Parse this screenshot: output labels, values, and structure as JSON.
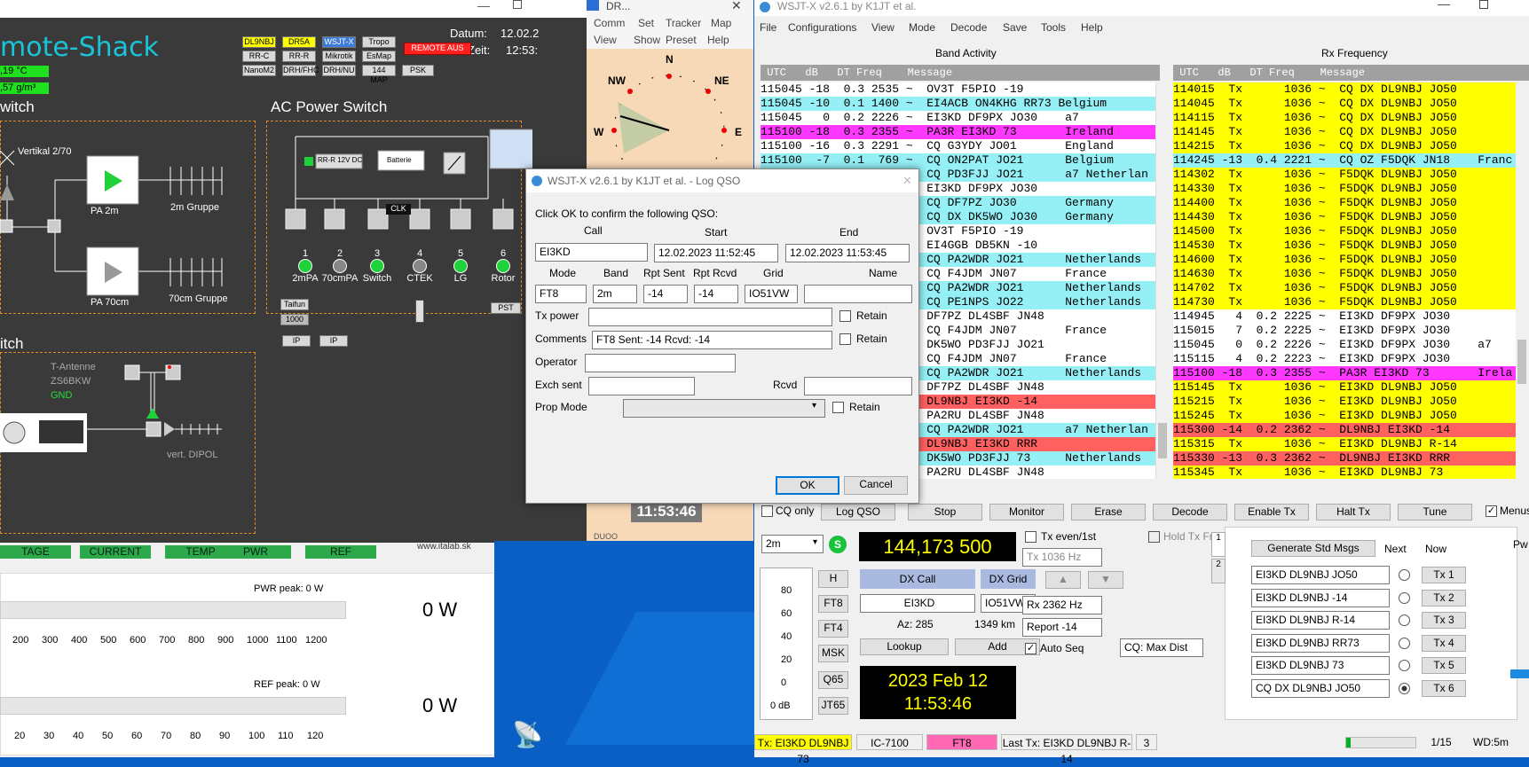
{
  "shack": {
    "title": "mote-Shack",
    "date_label": "Datum:",
    "date_value": "12.02.2",
    "time_label": "Zeit:",
    "time_value": "12:53:",
    "temp": ",19  °C",
    "humidity": ",57 g/m³",
    "buttons": [
      "DL9NBJ",
      "DR5A",
      "WSJT-X",
      "Tropo",
      "RR-C",
      "RR-R",
      "Mikrotik",
      "EsMap",
      "NanoM2",
      "DRH/FHC",
      "DRH/NU",
      "144 MAP",
      "PSK"
    ],
    "remote_off": "REMOTE AUS",
    "switch_header": "witch",
    "vertikal": "Vertikal 2/70",
    "pa2m": "PA 2m",
    "gruppe2m": "2m Gruppe",
    "pa70": "PA 70cm",
    "gruppe70": "70cm Gruppe",
    "ac_header": "AC Power Switch",
    "psu": "RR-R 12V DC",
    "batterie": "Batterie",
    "clk": "CLK",
    "outlets": [
      {
        "n": "1",
        "label": "2mPA",
        "on": true
      },
      {
        "n": "2",
        "label": "70cmPA",
        "on": false
      },
      {
        "n": "3",
        "label": "Switch",
        "on": true
      },
      {
        "n": "4",
        "label": "CTEK",
        "on": false
      },
      {
        "n": "5",
        "label": "LG",
        "on": true
      },
      {
        "n": "6",
        "label": "Rotor",
        "on": true
      }
    ],
    "taifun": "Taifun",
    "t1000": "1000",
    "pst": "PST",
    "ip": "IP",
    "switch2_header": "itch",
    "t_antenne": "T-Antenne",
    "zs6bkw": "ZS6BKW",
    "gnd": "GND",
    "vert_dipol": "vert. DIPOL",
    "tabs": [
      "TAGE",
      "CURRENT",
      "TEMP",
      "PWR",
      "REF"
    ],
    "website": "www.italab.sk",
    "pwr_peak": "PWR peak: 0 W",
    "pwr_value": "0 W",
    "pwr_ticks": [
      "200",
      "300",
      "400",
      "500",
      "600",
      "700",
      "800",
      "900",
      "1000",
      "1100",
      "1200"
    ],
    "ref_peak": "REF peak: 0 W",
    "ref_value": "0 W",
    "ref_ticks": [
      "20",
      "30",
      "40",
      "50",
      "60",
      "70",
      "80",
      "90",
      "100",
      "110",
      "120"
    ]
  },
  "dr": {
    "title": "DR...",
    "menu1": [
      "Comm",
      "Set",
      "Tracker",
      "Map"
    ],
    "menu2": [
      "View",
      "Show",
      "Preset",
      "Help"
    ],
    "compass": [
      "N",
      "NE",
      "E",
      "NW",
      "W"
    ],
    "clock": "11:53:46",
    "bottom": "DUOO"
  },
  "wsjt": {
    "title": "WSJT-X   v2.6.1   by K1JT et al.",
    "menu": [
      "File",
      "Configurations",
      "View",
      "Mode",
      "Decode",
      "Save",
      "Tools",
      "Help"
    ],
    "band_activity": "Band Activity",
    "rx_frequency": "Rx Frequency",
    "list_header": " UTC   dB   DT Freq    Message",
    "band_rows": [
      {
        "t": "115045 -18  0.3 2535 ~  OV3T F5PIO -19",
        "c": ""
      },
      {
        "t": "115045 -10  0.1 1400 ~  EI4ACB ON4KHG RR73 Belgium",
        "c": "cyan"
      },
      {
        "t": "115045   0  0.2 2226 ~  EI3KD DF9PX JO30    a7",
        "c": ""
      },
      {
        "t": "115100 -18  0.3 2355 ~  PA3R EI3KD 73       Ireland",
        "c": "mag"
      },
      {
        "t": "115100 -16  0.3 2291 ~  CQ G3YDY JO01       England",
        "c": ""
      },
      {
        "t": "115100  -7  0.1  769 ~  CQ ON2PAT JO21      Belgium",
        "c": "cyan"
      },
      {
        "t": "                        CQ PD3FJJ JO21      a7 Netherlan",
        "c": "cyan"
      },
      {
        "t": "                        EI3KD DF9PX JO30",
        "c": ""
      },
      {
        "t": "                        CQ DF7PZ JO30       Germany",
        "c": "cyan"
      },
      {
        "t": "                        CQ DX DK5WO JO30    Germany",
        "c": "cyan"
      },
      {
        "t": "                        OV3T F5PIO -19",
        "c": ""
      },
      {
        "t": "                        EI4GGB DB5KN -10",
        "c": ""
      },
      {
        "t": "                        CQ PA2WDR JO21      Netherlands",
        "c": "cyan"
      },
      {
        "t": "                        CQ F4JDM JN07       France",
        "c": ""
      },
      {
        "t": "                        CQ PA2WDR JO21      Netherlands",
        "c": "cyan"
      },
      {
        "t": "                        CQ PE1NPS JO22      Netherlands",
        "c": "cyan"
      },
      {
        "t": "                        DF7PZ DL4SBF JN48",
        "c": ""
      },
      {
        "t": "                        CQ F4JDM JN07       France",
        "c": ""
      },
      {
        "t": "                        DK5WO PD3FJJ JO21",
        "c": ""
      },
      {
        "t": "                        CQ F4JDM JN07       France",
        "c": ""
      },
      {
        "t": "                        CQ PA2WDR JO21      Netherlands",
        "c": "cyan"
      },
      {
        "t": "                        DF7PZ DL4SBF JN48",
        "c": ""
      },
      {
        "t": "                        DL9NBJ EI3KD -14",
        "c": "red"
      },
      {
        "t": "                        PA2RU DL4SBF JN48",
        "c": ""
      },
      {
        "t": "                        CQ PA2WDR JO21      a7 Netherlan",
        "c": "cyan"
      },
      {
        "t": "                        DL9NBJ EI3KD RRR",
        "c": "red"
      },
      {
        "t": "                        DK5WO PD3FJJ 73     Netherlands",
        "c": "cyan"
      },
      {
        "t": "                        PA2RU DL4SBF JN48",
        "c": ""
      }
    ],
    "rx_rows": [
      {
        "t": "114015  Tx      1036 ~  CQ DX DL9NBJ JO50",
        "c": "yel"
      },
      {
        "t": "114045  Tx      1036 ~  CQ DX DL9NBJ JO50",
        "c": "yel"
      },
      {
        "t": "114115  Tx      1036 ~  CQ DX DL9NBJ JO50",
        "c": "yel"
      },
      {
        "t": "114145  Tx      1036 ~  CQ DX DL9NBJ JO50",
        "c": "yel"
      },
      {
        "t": "114215  Tx      1036 ~  CQ DX DL9NBJ JO50",
        "c": "yel"
      },
      {
        "t": "114245 -13  0.4 2221 ~  CQ OZ F5DQK JN18    Franc",
        "c": "cyan"
      },
      {
        "t": "114302  Tx      1036 ~  F5DQK DL9NBJ JO50",
        "c": "yel"
      },
      {
        "t": "114330  Tx      1036 ~  F5DQK DL9NBJ JO50",
        "c": "yel"
      },
      {
        "t": "114400  Tx      1036 ~  F5DQK DL9NBJ JO50",
        "c": "yel"
      },
      {
        "t": "114430  Tx      1036 ~  F5DQK DL9NBJ JO50",
        "c": "yel"
      },
      {
        "t": "114500  Tx      1036 ~  F5DQK DL9NBJ JO50",
        "c": "yel"
      },
      {
        "t": "114530  Tx      1036 ~  F5DQK DL9NBJ JO50",
        "c": "yel"
      },
      {
        "t": "114600  Tx      1036 ~  F5DQK DL9NBJ JO50",
        "c": "yel"
      },
      {
        "t": "114630  Tx      1036 ~  F5DQK DL9NBJ JO50",
        "c": "yel"
      },
      {
        "t": "114702  Tx      1036 ~  F5DQK DL9NBJ JO50",
        "c": "yel"
      },
      {
        "t": "114730  Tx      1036 ~  F5DQK DL9NBJ JO50",
        "c": "yel"
      },
      {
        "t": "114945   4  0.2 2225 ~  EI3KD DF9PX JO30",
        "c": ""
      },
      {
        "t": "115015   7  0.2 2225 ~  EI3KD DF9PX JO30",
        "c": ""
      },
      {
        "t": "115045   0  0.2 2226 ~  EI3KD DF9PX JO30    a7",
        "c": ""
      },
      {
        "t": "115115   4  0.2 2223 ~  EI3KD DF9PX JO30",
        "c": ""
      },
      {
        "t": "115100 -18  0.3 2355 ~  PA3R EI3KD 73       Irela",
        "c": "mag"
      },
      {
        "t": "115145  Tx      1036 ~  EI3KD DL9NBJ JO50",
        "c": "yel"
      },
      {
        "t": "115215  Tx      1036 ~  EI3KD DL9NBJ JO50",
        "c": "yel"
      },
      {
        "t": "115245  Tx      1036 ~  EI3KD DL9NBJ JO50",
        "c": "yel"
      },
      {
        "t": "115300 -14  0.2 2362 ~  DL9NBJ EI3KD -14",
        "c": "red"
      },
      {
        "t": "115315  Tx      1036 ~  EI3KD DL9NBJ R-14",
        "c": "yel"
      },
      {
        "t": "115330 -13  0.3 2362 ~  DL9NBJ EI3KD RRR",
        "c": "red"
      },
      {
        "t": "115345  Tx      1036 ~  EI3KD DL9NBJ 73",
        "c": "yel"
      }
    ],
    "cq_only": "CQ only",
    "buttons": [
      "Log QSO",
      "Stop",
      "Monitor",
      "Erase",
      "Decode",
      "Enable Tx",
      "Halt Tx",
      "Tune"
    ],
    "menus": "Menus",
    "band": "2m",
    "frequency": "144,173 500",
    "tx_even": "Tx even/1st",
    "hold_tx_freq": "Hold Tx Freq",
    "tx_hz": "Tx  1036  Hz",
    "rx_hz": "Rx  2362  Hz",
    "report": "Report -14",
    "auto_seq": "Auto Seq",
    "cq_max_dist": "CQ: Max Dist",
    "dx_call_label": "DX Call",
    "dx_grid_label": "DX Grid",
    "dx_call": "EI3KD",
    "dx_grid": "IO51VW",
    "az": "Az: 285",
    "km": "1349 km",
    "lookup": "Lookup",
    "add": "Add",
    "date": "2023 Feb 12",
    "clock": "11:53:46",
    "modes": [
      "H",
      "FT8",
      "FT4",
      "MSK",
      "Q65",
      "JT65"
    ],
    "meter_ticks": [
      "80",
      "60",
      "40",
      "20",
      "0"
    ],
    "meter_db": "0 dB",
    "gen_std": "Generate Std Msgs",
    "next": "Next",
    "now": "Now",
    "tx_msgs": [
      "EI3KD DL9NBJ JO50",
      "EI3KD DL9NBJ -14",
      "EI3KD DL9NBJ R-14",
      "EI3KD DL9NBJ RR73",
      "EI3KD DL9NBJ 73",
      "CQ DX DL9NBJ JO50"
    ],
    "tx_btns": [
      "Tx 1",
      "Tx 2",
      "Tx 3",
      "Tx 4",
      "Tx 5",
      "Tx 6"
    ],
    "tab1": "1",
    "tab2": "2",
    "pw": "Pw",
    "status_tx": "Tx: EI3KD DL9NBJ 73",
    "status_rig": "IC-7100",
    "status_mode": "FT8",
    "status_last": "Last Tx: EI3KD DL9NBJ R-14",
    "status_num": "3",
    "status_period": "1/15",
    "status_wd": "WD:5m"
  },
  "dialog": {
    "title": "WSJT-X   v2.6.1   by K1JT et al. - Log QSO",
    "prompt": "Click OK to confirm the following QSO:",
    "call_label": "Call",
    "start_label": "Start",
    "end_label": "End",
    "call": "EI3KD",
    "start": "12.02.2023 11:52:45",
    "end": "12.02.2023 11:53:45",
    "mode_label": "Mode",
    "band_label": "Band",
    "rpt_sent_label": "Rpt Sent",
    "rpt_rcvd_label": "Rpt Rcvd",
    "grid_label": "Grid",
    "name_label": "Name",
    "mode": "FT8",
    "band": "2m",
    "rpt_sent": "-14",
    "rpt_rcvd": "-14",
    "grid": "IO51VW",
    "name": "",
    "tx_power_label": "Tx power",
    "retain": "Retain",
    "comments_label": "Comments",
    "comments": "FT8  Sent: -14  Rcvd: -14",
    "operator_label": "Operator",
    "exch_sent_label": "Exch sent",
    "rcvd_label": "Rcvd",
    "prop_mode_label": "Prop Mode",
    "ok": "OK",
    "cancel": "Cancel"
  }
}
